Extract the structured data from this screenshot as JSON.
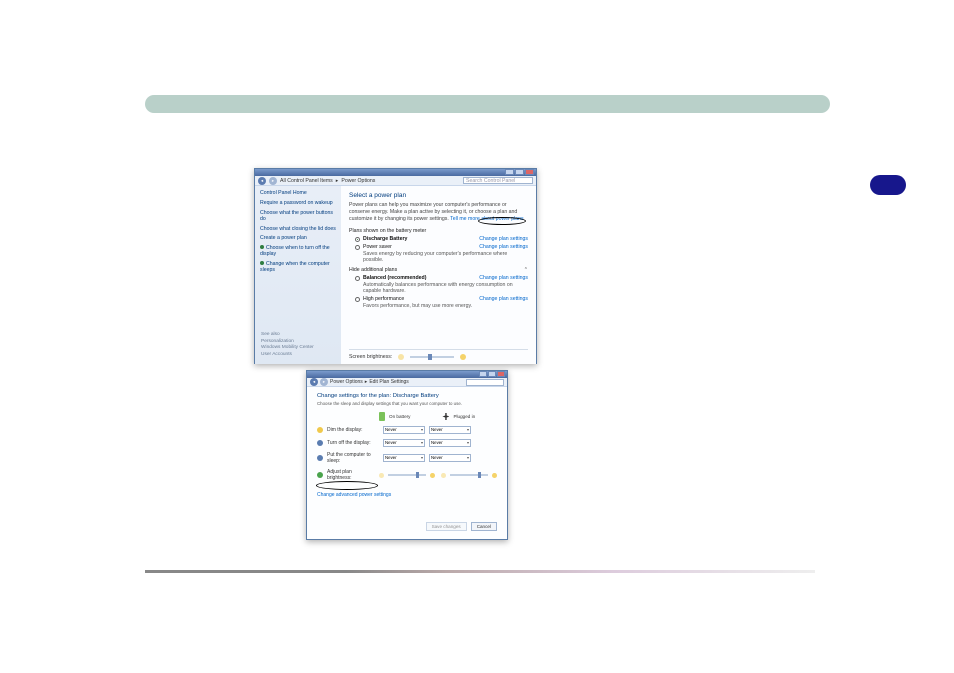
{
  "colors": {
    "accent": "#0066cc",
    "side": "#e8eef7",
    "title": "#003c7e"
  },
  "window1": {
    "breadcrumb_prefix": "▸",
    "breadcrumb1": "All Control Panel Items",
    "breadcrumb2": "Power Options",
    "search_placeholder": "Search Control Panel",
    "side_home": "Control Panel Home",
    "side_links": [
      "Require a password on wakeup",
      "Choose what the power buttons do",
      "Choose what closing the lid does",
      "Create a power plan",
      "Choose when to turn off the display",
      "Change when the computer sleeps"
    ],
    "see_also_title": "See also",
    "see_also": [
      "Personalization",
      "Windows Mobility Center",
      "User Accounts"
    ],
    "heading": "Select a power plan",
    "description": "Power plans can help you maximize your computer's performance or conserve energy. Make a plan active by selecting it, or choose a plan and customize it by changing its power settings.",
    "tell_more": "Tell me more about power plans",
    "plans_label": "Plans shown on the battery meter",
    "change_plan_settings": "Change plan settings",
    "plans_primary": [
      {
        "name": "Discharge Battery",
        "sub": "",
        "selected": true
      },
      {
        "name": "Power saver",
        "sub": "Saves energy by reducing your computer's performance where possible.",
        "selected": false
      }
    ],
    "hide_plans": "Hide additional plans",
    "plans_extra": [
      {
        "name": "Balanced (recommended)",
        "sub": "Automatically balances performance with energy consumption on capable hardware.",
        "selected": false
      },
      {
        "name": "High performance",
        "sub": "Favors performance, but may use more energy.",
        "selected": false
      }
    ],
    "brightness_label": "Screen brightness:"
  },
  "window2": {
    "breadcrumb1": "Power Options",
    "breadcrumb2": "Edit Plan Settings",
    "heading": "Change settings for the plan: Discharge Battery",
    "sub": "Choose the sleep and display settings that you want your computer to use.",
    "col_batt": "On battery",
    "col_plug": "Plugged in",
    "rows": [
      {
        "label": "Dim the display:",
        "batt": "Never",
        "plug": "Never"
      },
      {
        "label": "Turn off the display:",
        "batt": "Never",
        "plug": "Never"
      },
      {
        "label": "Put the computer to sleep:",
        "batt": "Never",
        "plug": "Never"
      }
    ],
    "row_bright": "Adjust plan brightness:",
    "advanced_link": "Change advanced power settings",
    "save_btn": "Save changes",
    "cancel_btn": "Cancel"
  }
}
